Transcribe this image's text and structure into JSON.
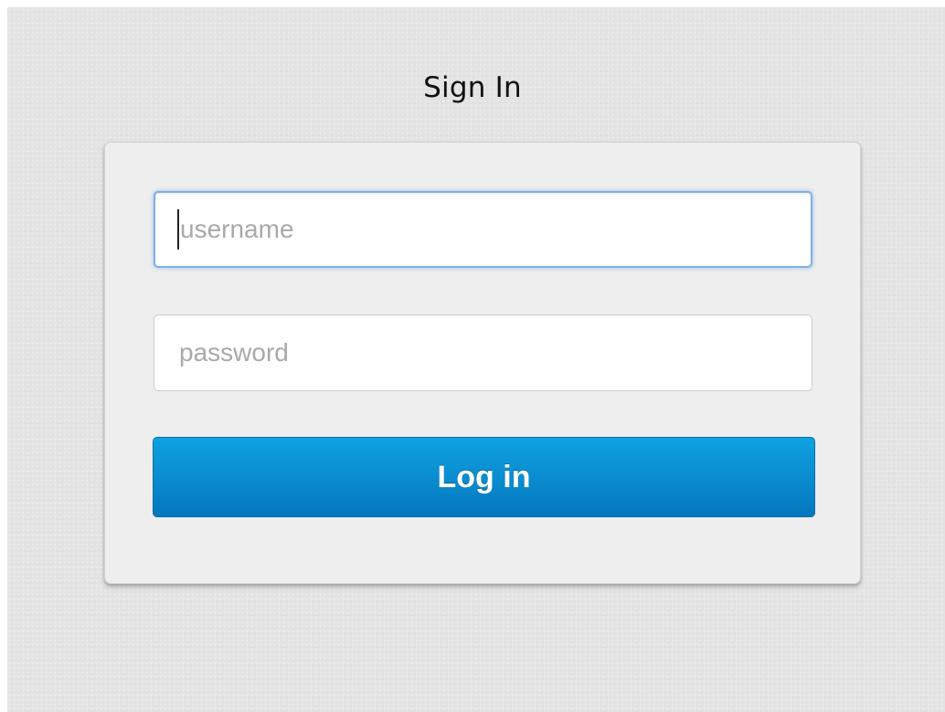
{
  "page": {
    "title": "Sign In"
  },
  "login_form": {
    "username": {
      "value": "",
      "placeholder": "username",
      "focused": true
    },
    "password": {
      "value": "",
      "placeholder": "password"
    },
    "submit_label": "Log in"
  },
  "colors": {
    "background": "#e3e3e3",
    "card": "#eeeeee",
    "focus_ring": "#7fb0e6",
    "button": "#0a8dd0",
    "button_text": "#ffffff"
  }
}
